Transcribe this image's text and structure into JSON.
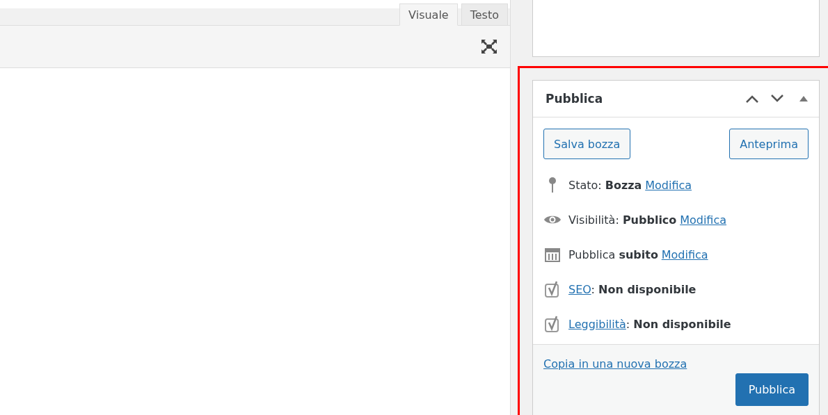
{
  "editor": {
    "tabs": [
      {
        "label": "Visuale",
        "selected": true
      },
      {
        "label": "Testo",
        "selected": false
      }
    ]
  },
  "publish_box": {
    "title": "Pubblica",
    "buttons": [
      "Salva bozza",
      "Anteprima"
    ],
    "rows": [
      {
        "kind": "status",
        "parts": [
          {
            "kind": "text",
            "text": "Stato: "
          },
          {
            "kind": "bold",
            "text": "Bozza"
          },
          {
            "kind": "link",
            "text": "Modifica"
          }
        ]
      },
      {
        "kind": "visibility",
        "parts": [
          {
            "kind": "text",
            "text": "Visibilità: "
          },
          {
            "kind": "bold",
            "text": "Pubblico"
          },
          {
            "kind": "link",
            "text": "Modifica"
          }
        ]
      },
      {
        "kind": "schedule",
        "parts": [
          {
            "kind": "text",
            "text": "Pubblica "
          },
          {
            "kind": "bold",
            "text": "subito"
          },
          {
            "kind": "link",
            "text": "Modifica"
          }
        ]
      },
      {
        "kind": "seo",
        "parts": [
          {
            "kind": "link",
            "text": "SEO"
          },
          {
            "kind": "text",
            "text": ": "
          },
          {
            "kind": "bold",
            "text": "Non disponibile"
          }
        ]
      },
      {
        "kind": "readability",
        "parts": [
          {
            "kind": "link",
            "text": "Leggibilità"
          },
          {
            "kind": "text",
            "text": ": "
          },
          {
            "kind": "bold",
            "text": "Non disponibile"
          }
        ]
      }
    ],
    "copy_link": "Copia in una nuova bozza",
    "publish_button": "Pubblica"
  }
}
